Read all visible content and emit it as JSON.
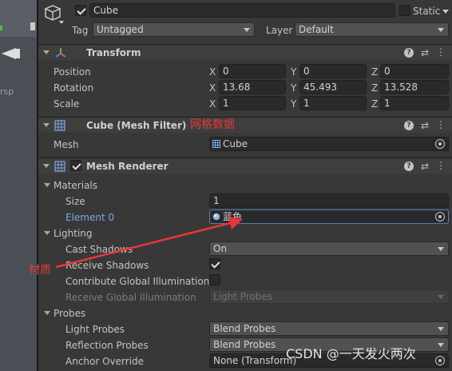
{
  "scene_view": {
    "side_label": "rsp"
  },
  "object": {
    "enabled": true,
    "name": "Cube",
    "static_label": "Static",
    "tag_label": "Tag",
    "tag_value": "Untagged",
    "layer_label": "Layer",
    "layer_value": "Default"
  },
  "transform": {
    "title": "Transform",
    "position_label": "Position",
    "rotation_label": "Rotation",
    "scale_label": "Scale",
    "axis_x": "X",
    "axis_y": "Y",
    "axis_z": "Z",
    "position": {
      "x": "0",
      "y": "0",
      "z": "0"
    },
    "rotation": {
      "x": "13.68",
      "y": "45.493",
      "z": "13.528"
    },
    "scale": {
      "x": "1",
      "y": "1",
      "z": "1"
    }
  },
  "mesh_filter": {
    "title": "Cube (Mesh Filter)",
    "annotation": "网格数据",
    "mesh_label": "Mesh",
    "mesh_value": "Cube"
  },
  "mesh_renderer": {
    "enabled": true,
    "title": "Mesh Renderer",
    "materials_label": "Materials",
    "size_label": "Size",
    "size_value": "1",
    "element0_label": "Element 0",
    "element0_value": "蓝色",
    "lighting_label": "Lighting",
    "cast_shadows_label": "Cast Shadows",
    "cast_shadows_value": "On",
    "receive_shadows_label": "Receive Shadows",
    "receive_shadows_checked": true,
    "contribute_gi_label": "Contribute Global Illumination",
    "contribute_gi_checked": false,
    "receive_gi_label": "Receive Global Illumination",
    "receive_gi_value": "Light Probes",
    "probes_label": "Probes",
    "light_probes_label": "Light Probes",
    "light_probes_value": "Blend Probes",
    "reflection_probes_label": "Reflection Probes",
    "reflection_probes_value": "Blend Probes",
    "anchor_override_label": "Anchor Override",
    "anchor_override_value": "None (Transform)"
  },
  "annotations": {
    "material_note": "材质",
    "watermark": "CSDN @一天发火两次"
  },
  "colors": {
    "annotation_red": "#e8373a",
    "element_blue": "#7aa8e8",
    "panel_bg": "#383838"
  }
}
